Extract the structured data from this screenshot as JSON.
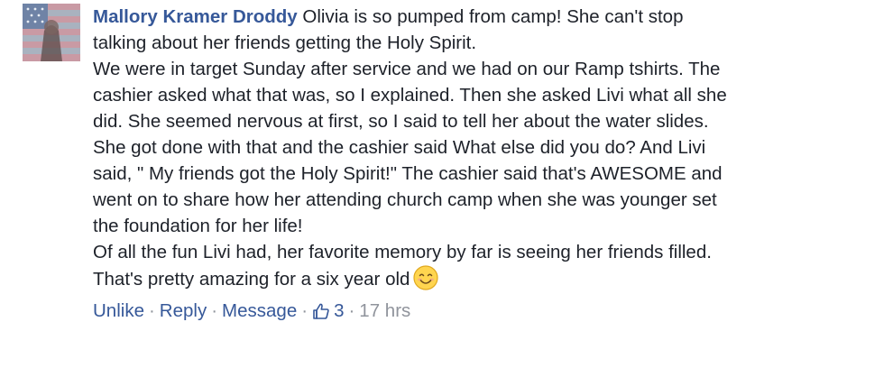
{
  "comment": {
    "author": "Mallory Kramer Droddy",
    "lines": [
      "Olivia is so pumped from camp! She can't stop",
      "talking about her friends getting the Holy Spirit.",
      "We were in target Sunday after service and we had on our Ramp tshirts. The",
      "cashier asked what that was, so I explained. Then she asked Livi what all she",
      "did. She seemed nervous at first, so I said to tell her about the water slides.",
      "She got done with that and the cashier said What else did you do? And Livi",
      "said, \" My friends got the Holy Spirit!\" The cashier said that's AWESOME and",
      "went on to share how her attending church camp when she was younger set",
      "the foundation for her life!",
      "Of all the fun Livi had, her favorite memory by far is seeing her friends filled.",
      "That's pretty amazing for a six year old"
    ],
    "emoji": "smiling-face-emoji"
  },
  "actions": {
    "unlike": "Unlike",
    "reply": "Reply",
    "message": "Message",
    "like_count": "3",
    "time": "17 hrs",
    "separator": "·"
  },
  "colors": {
    "link": "#365899",
    "text": "#1d2129",
    "muted": "#90949c"
  }
}
